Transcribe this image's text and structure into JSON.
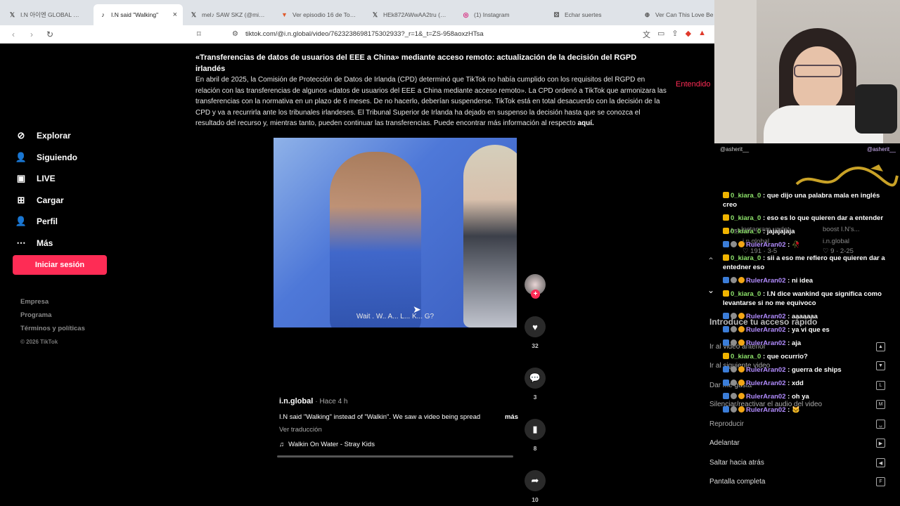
{
  "browser": {
    "tabs": [
      {
        "icon": "x-icon",
        "label": "I.N 아이엔 GLOBAL 🌷 en",
        "active": false
      },
      {
        "icon": "tiktok-icon",
        "label": "I.N said \"Walking\"",
        "active": true
      },
      {
        "icon": "x-icon",
        "label": "mel♪ SAW SKZ (@minsun",
        "active": false
      },
      {
        "icon": "tv-icon",
        "label": "Ver episodio 16 de Toujin",
        "active": false
      },
      {
        "icon": "x-icon",
        "label": "HEk872AWwAA2tru (1836",
        "active": false
      },
      {
        "icon": "instagram-icon",
        "label": "(1) Instagram",
        "active": false
      },
      {
        "icon": "dice-icon",
        "label": "Echar suertes",
        "active": false
      },
      {
        "icon": "globe-icon",
        "label": "Ver Can This Love Be Tran",
        "active": false
      }
    ],
    "url": "tiktok.com/@i.n.global/video/7623238698175302933?_r=1&_t=ZS-958aoxzHTsa"
  },
  "notice": {
    "title": "«Transferencias de datos de usuarios del EEE a China» mediante acceso remoto: actualización de la decisión del RGPD irlandés",
    "body": "En abril de 2025, la Comisión de Protección de Datos de Irlanda (CPD) determinó que TikTok no había cumplido con los requisitos del RGPD en relación con las transferencias de algunos «datos de usuarios del EEE a China mediante acceso remoto». La CPD ordenó a TikTok que armonizara las transferencias con la normativa en un plazo de 6 meses. De no hacerlo, deberían suspenderse. TikTok está en total desacuerdo con la decisión de la CPD y va a recurrirla ante los tribunales irlandeses. El Tribunal Superior de Irlanda ha dejado en suspenso la decisión hasta que se conozca el resultado del recurso y, mientras tanto, pueden continuar las transferencias. Puede encontrar más información al respecto",
    "link": "aquí.",
    "dismiss": "Entendido"
  },
  "sidebar": {
    "items": [
      {
        "icon": "compass-icon",
        "label": "Explorar"
      },
      {
        "icon": "following-icon",
        "label": "Siguiendo"
      },
      {
        "icon": "live-icon",
        "label": "LIVE"
      },
      {
        "icon": "upload-icon",
        "label": "Cargar"
      },
      {
        "icon": "profile-icon",
        "label": "Perfil"
      },
      {
        "icon": "more-icon",
        "label": "Más"
      }
    ],
    "login": "Iniciar sesión",
    "footer": [
      "Empresa",
      "Programa",
      "Términos y políticas"
    ],
    "copyright": "© 2026 TikTok"
  },
  "video": {
    "caption": "Wait . W.. A... L... K... G?",
    "author": "i.n.global",
    "time_ago": "· Hace 4 h",
    "description": "I.N said \"Walking\" instead of \"Walkin\". We saw a video being spread",
    "more": "más",
    "translate": "Ver traducción",
    "music": "Walkin On Water - Stray Kids",
    "likes": "32",
    "comments": "3",
    "saves": "8",
    "shares": "10"
  },
  "stream": {
    "overlay_left": "@asherit__",
    "overlay_right": "@asherit__",
    "ghost": {
      "mention": "@Ashent",
      "ig_update": "Instagram updat...",
      "ig_stats": "♡ 191 · 3-5",
      "boost": "I STAY, I...",
      "boost2": "boost I.N's...",
      "handle": "i.n.global",
      "handle2": "i.n.global",
      "stats2": "♡ 9 · 2-25"
    },
    "shortcuts_title": "Introduce tu acceso rápido",
    "shortcuts_ghost": [
      {
        "label": "Ir al video anterior",
        "key": "▲"
      },
      {
        "label": "Ir al siguiente video",
        "key": "▼"
      },
      {
        "label": "Dar me gusta",
        "key": "L"
      },
      {
        "label": "Silenciar/reactivar el audio del video",
        "key": "M"
      },
      {
        "label": "Reproducir",
        "key": "␣"
      }
    ],
    "shortcuts": [
      {
        "label": "Adelantar",
        "key": "▶"
      },
      {
        "label": "Saltar hacia atrás",
        "key": "◀"
      },
      {
        "label": "Pantalla completa",
        "key": "F"
      }
    ],
    "chat": [
      {
        "user": "0_kiara_0",
        "badges": [
          "y"
        ],
        "text": ": que dijo una palabra mala en inglés creo",
        "color": "u1"
      },
      {
        "user": "0_kiara_0",
        "badges": [
          "y"
        ],
        "text": ": eso es lo que quieren dar a entender",
        "color": "u1"
      },
      {
        "user": "0_kiara_0",
        "badges": [
          "y"
        ],
        "text": ": jajajajaja",
        "color": "u1"
      },
      {
        "user": "RulerAran02",
        "badges": [
          "b",
          "g",
          "o"
        ],
        "text": ": 🥀",
        "color": "u2"
      },
      {
        "user": "0_kiara_0",
        "badges": [
          "y"
        ],
        "text": ": sii a eso me refiero que quieren dar a entedner eso",
        "color": "u1"
      },
      {
        "user": "RulerAran02",
        "badges": [
          "b",
          "g",
          "o"
        ],
        "text": ": ni idea",
        "color": "u2"
      },
      {
        "user": "0_kiara_0",
        "badges": [
          "y"
        ],
        "text": ": I.N dice wankind que significa como levantarse si no me equivoco",
        "color": "u1"
      },
      {
        "user": "RulerAran02",
        "badges": [
          "b",
          "g",
          "o"
        ],
        "text": ": aaaaaaa",
        "color": "u2"
      },
      {
        "user": "RulerAran02",
        "badges": [
          "b",
          "g",
          "o"
        ],
        "text": ": ya vi que es",
        "color": "u2"
      },
      {
        "user": "RulerAran02",
        "badges": [
          "b",
          "g",
          "o"
        ],
        "text": ": aja",
        "color": "u2"
      },
      {
        "user": "0_kiara_0",
        "badges": [
          "y"
        ],
        "text": ": que ocurrio?",
        "color": "u1"
      },
      {
        "user": "RulerAran02",
        "badges": [
          "b",
          "g",
          "o"
        ],
        "text": ": guerra de ships",
        "color": "u2"
      },
      {
        "user": "RulerAran02",
        "badges": [
          "b",
          "g",
          "o"
        ],
        "text": ": xdd",
        "color": "u2"
      },
      {
        "user": "RulerAran02",
        "badges": [
          "b",
          "g",
          "o"
        ],
        "text": ": oh ya",
        "color": "u2"
      },
      {
        "user": "RulerAran02",
        "badges": [
          "b",
          "g",
          "o"
        ],
        "text": ": 🐱",
        "color": "u2"
      }
    ]
  },
  "colors": {
    "accent": "#fe2c55",
    "background": "#000000"
  }
}
